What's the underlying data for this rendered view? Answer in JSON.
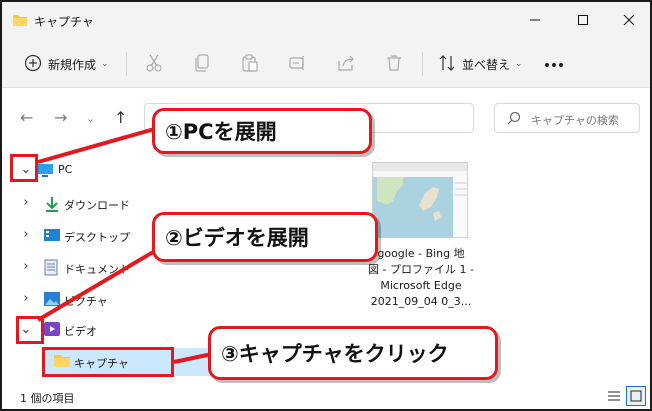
{
  "window": {
    "title": "キャプチャ"
  },
  "toolbar": {
    "new_label": "新規作成",
    "sort_label": "並べ替え"
  },
  "search": {
    "placeholder": "キャプチャの検索"
  },
  "nav": {
    "items": [
      {
        "label": "PC"
      },
      {
        "label": "ダウンロード"
      },
      {
        "label": "デスクトップ"
      },
      {
        "label": "ドキュメント"
      },
      {
        "label": "ピクチャ"
      },
      {
        "label": "ビデオ"
      },
      {
        "label": "キャプチャ"
      }
    ]
  },
  "file": {
    "name_line1": "google - Bing 地",
    "name_line2": "図 - プロファイル 1 -",
    "name_line3": "Microsoft Edge",
    "name_line4": "2021_09_04 0_3..."
  },
  "status": {
    "count_text": "1 個の項目"
  },
  "annotations": {
    "step1": "①PCを展開",
    "step2": "②ビデオを展開",
    "step3": "③キャプチャをクリック"
  },
  "colors": {
    "annotation_red": "#e3191f",
    "selection": "#cce8ff",
    "folder": "#f6c350"
  }
}
